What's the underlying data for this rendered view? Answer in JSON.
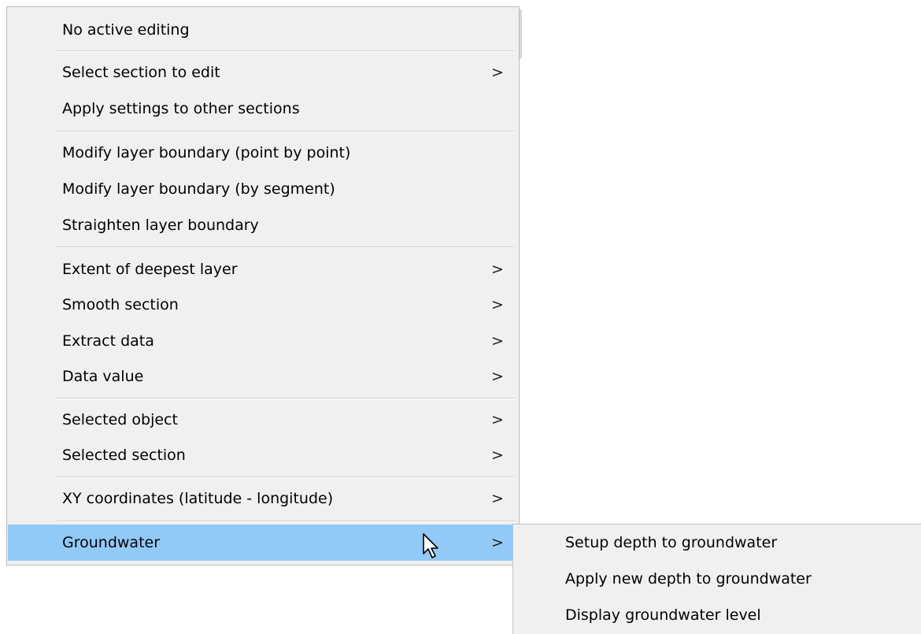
{
  "menu": {
    "items": [
      {
        "label": "No active editing",
        "arrow": ""
      },
      {
        "label": "Select section to edit",
        "arrow": ">"
      },
      {
        "label": "Apply settings to other sections",
        "arrow": ""
      },
      {
        "label": "Modify layer boundary (point by point)",
        "arrow": ""
      },
      {
        "label": "Modify layer boundary (by segment)",
        "arrow": ""
      },
      {
        "label": "Straighten layer boundary",
        "arrow": ""
      },
      {
        "label": "Extent of deepest layer",
        "arrow": ">"
      },
      {
        "label": "Smooth section",
        "arrow": ">"
      },
      {
        "label": "Extract data",
        "arrow": ">"
      },
      {
        "label": "Data value",
        "arrow": ">"
      },
      {
        "label": "Selected object",
        "arrow": ">"
      },
      {
        "label": "Selected section",
        "arrow": ">"
      },
      {
        "label": "XY coordinates (latitude - longitude)",
        "arrow": ">"
      },
      {
        "label": "Groundwater",
        "arrow": ">"
      }
    ]
  },
  "submenu": {
    "items": [
      {
        "label": "Setup depth to groundwater"
      },
      {
        "label": "Apply new depth to groundwater"
      },
      {
        "label": "Display groundwater level"
      }
    ]
  },
  "colors": {
    "menu_background": "#f0f0f0",
    "highlight": "#91c9f7",
    "separator": "#d2d2d2"
  }
}
